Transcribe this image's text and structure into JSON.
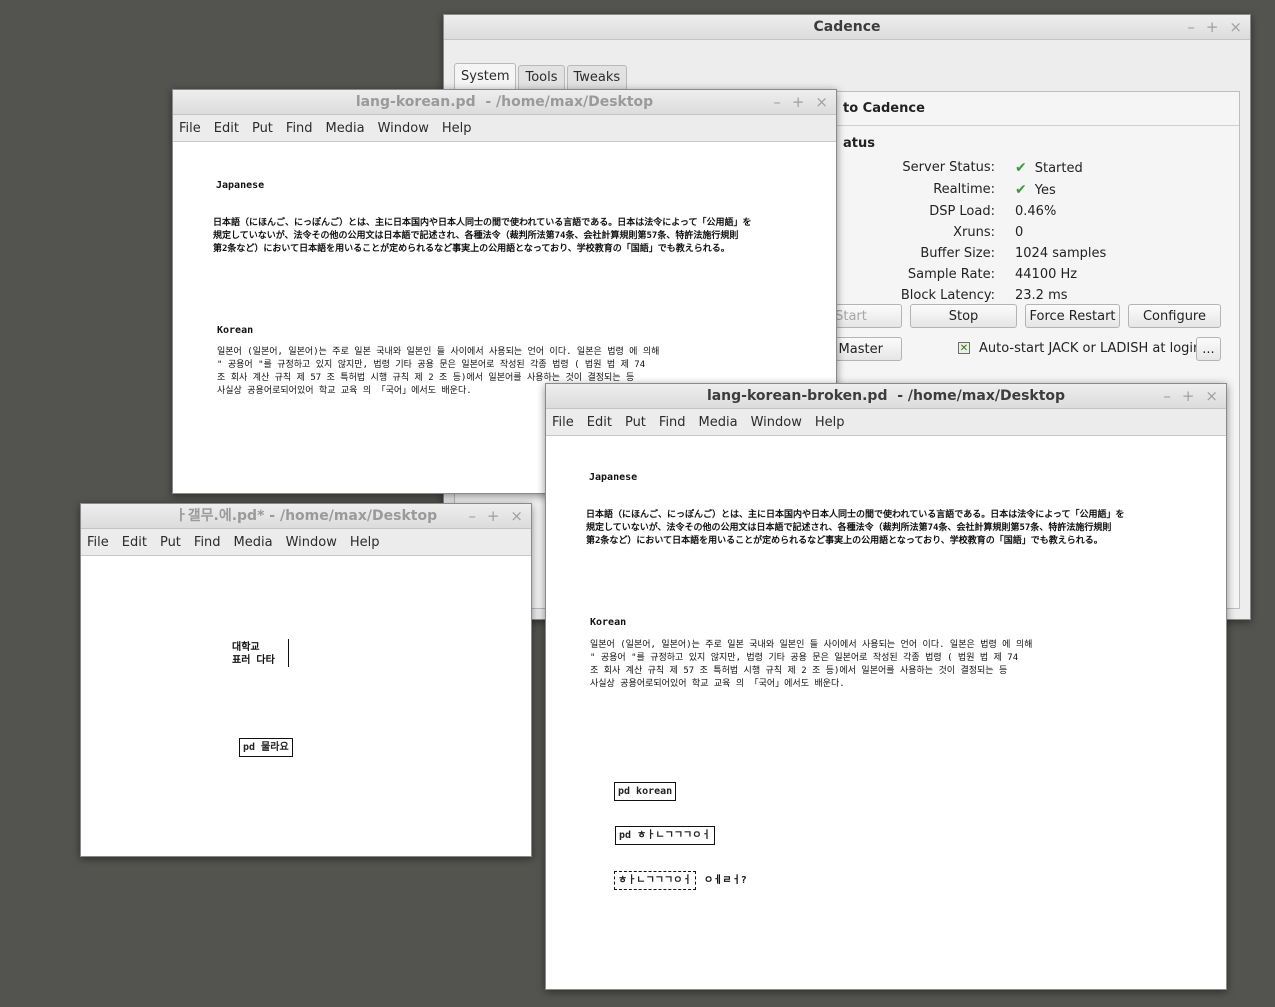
{
  "cadence": {
    "title": "Cadence",
    "tabs": [
      "System",
      "Tools",
      "Tweaks"
    ],
    "welcome": "to Cadence",
    "section": "atus",
    "status": [
      {
        "label": "Server Status:",
        "value": "Started",
        "check": true
      },
      {
        "label": "Realtime:",
        "value": "Yes",
        "check": true
      },
      {
        "label": "DSP Load:",
        "value": "0.46%",
        "check": false
      },
      {
        "label": "Xruns:",
        "value": "0",
        "check": false
      },
      {
        "label": "Buffer Size:",
        "value": "1024 samples",
        "check": false
      },
      {
        "label": "Sample Rate:",
        "value": "44100 Hz",
        "check": false
      },
      {
        "label": "Block Latency:",
        "value": "23.2 ms",
        "check": false
      }
    ],
    "buttons": {
      "start": "Start",
      "stop": "Stop",
      "force_restart": "Force Restart",
      "configure": "Configure",
      "switch_master": "ch Master",
      "more": "..."
    },
    "autostart_label": "Auto-start JACK or LADISH at login"
  },
  "menu": [
    "File",
    "Edit",
    "Put",
    "Find",
    "Media",
    "Window",
    "Help"
  ],
  "window_buttons": {
    "minimize": "–",
    "maximize": "+",
    "close": "×"
  },
  "win_korean": {
    "title": "lang-korean.pd  - /home/max/Desktop",
    "japanese_heading": "Japanese",
    "japanese_text": "日本語（にほんご、にっぽんご）とは、主に日本国内や日本人同士の間で使われている言語である。日本は法令によって「公用語」を\n規定していないが、法令その他の公用文は日本語で記述され、各種法令（裁判所法第74条、会社計算規則第57条、特許法施行規則\n第2条など）において日本語を用いることが定められるなど事実上の公用語となっており、学校教育の「国語」でも教えられる。",
    "korean_heading": "Korean",
    "korean_text": "일본어 (일본어, 일본어)는 주로 일본 국내와 일본인 들 사이에서 사용되는 언어 이다. 일본은 법령 에 의해\n\" 공용어 \"를 규정하고 있지 않지만, 법령 기타 공용 문은 일본어로 작성된 각종 법령 ( 법원 법 제 74\n조 회사 계산 규칙 제 57 조 특허법 시행 규칙 제 2 조 등)에서 일본어를 사용하는 것이 결정되는 등\n사실상 공용어로되어있어 학교 교육 의 「국어」에서도 배운다."
  },
  "win_small": {
    "title": "ㅏ갤무.에.pd* - /home/max/Desktop",
    "comment": "대학교\n표러 다타",
    "object": "pd 물라요"
  },
  "win_broken": {
    "title": "lang-korean-broken.pd  - /home/max/Desktop",
    "object1": "pd korean",
    "object2": "pd ㅎㅏㄴㄱㄱㄱㅇㅓ",
    "object3_box": "ㅎㅏㄴㄱㄱㄱㅇㅓ",
    "object3_rest": "ㅇㅔㄹㅓ?"
  }
}
